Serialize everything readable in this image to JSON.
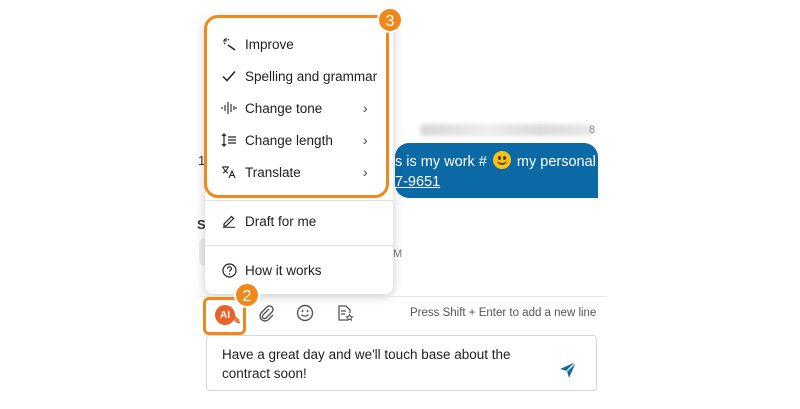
{
  "menu": {
    "items": [
      {
        "label": "Improve",
        "icon": "magic-wand-icon",
        "has_submenu": false
      },
      {
        "label": "Spelling and grammar",
        "icon": "checkmark-icon",
        "has_submenu": false
      },
      {
        "label": "Change tone",
        "icon": "audio-wave-icon",
        "has_submenu": true
      },
      {
        "label": "Change length",
        "icon": "text-length-icon",
        "has_submenu": true
      },
      {
        "label": "Translate",
        "icon": "translate-icon",
        "has_submenu": true
      },
      {
        "label": "Draft for me",
        "icon": "pencil-icon",
        "has_submenu": false
      },
      {
        "label": "How it works",
        "icon": "help-circle-icon",
        "has_submenu": false
      }
    ],
    "chevron": "›"
  },
  "callouts": {
    "menu_number": "3",
    "ai_button_number": "2"
  },
  "background": {
    "sender_digit": "8",
    "left_fragment_1": "1",
    "left_fragment_2": "S",
    "bubble_line1_before": "s is my work #",
    "bubble_line1_after": "my personal",
    "bubble_line2": "7-9651",
    "time_fragment": "M"
  },
  "toolbar": {
    "ai_label": "AI",
    "hint": "Press Shift + Enter to add a new line"
  },
  "composer": {
    "text": "Have a great day and we'll touch base about the contract soon!"
  },
  "colors": {
    "accent": "#f0891b",
    "bubble": "#0b69a6",
    "send": "#0b69a6",
    "ai": "#e8622a"
  }
}
